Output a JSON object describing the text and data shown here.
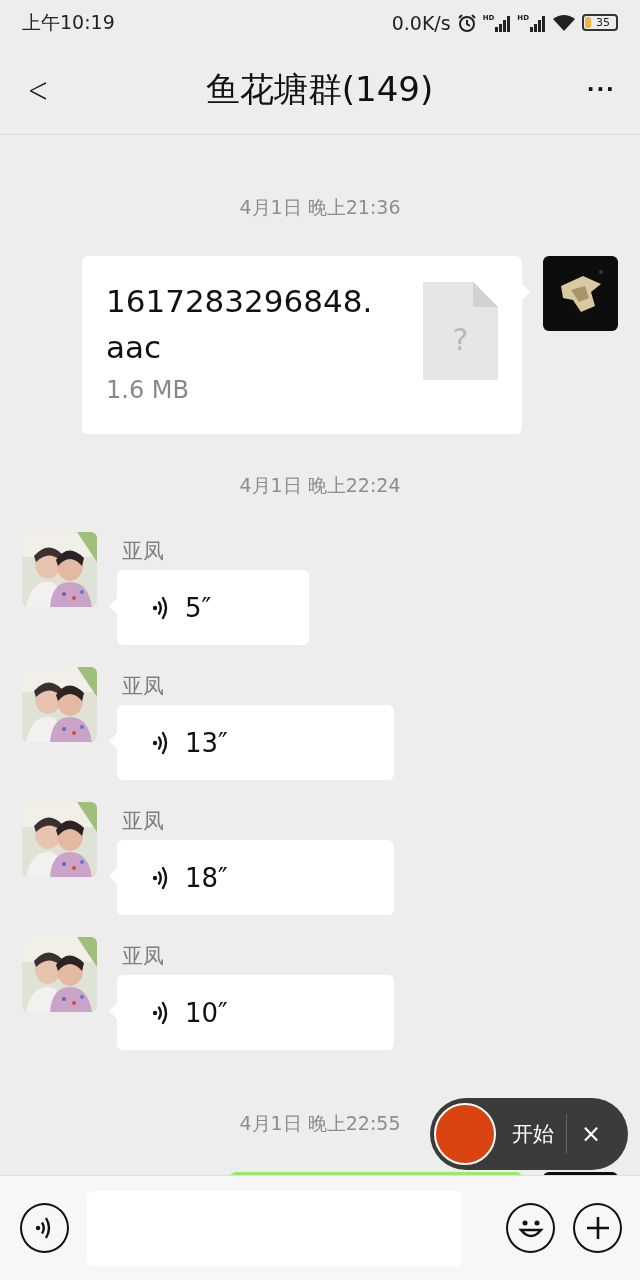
{
  "status_bar": {
    "time": "上午10:19",
    "speed": "0.0K/s",
    "sim_labels": [
      "HD",
      "HD"
    ],
    "battery": "35"
  },
  "header": {
    "title": "鱼花塘群(149)",
    "back": "<",
    "more": "···"
  },
  "messages": [
    {
      "kind": "time",
      "text": "4月1日 晚上21:36"
    },
    {
      "kind": "file",
      "filename": "1617283296848.aac",
      "size": "1.6 MB",
      "icon_glyph": "?"
    },
    {
      "kind": "time",
      "text": "4月1日 晚上22:24"
    },
    {
      "kind": "voice",
      "sender": "亚凤",
      "duration": "5″"
    },
    {
      "kind": "voice",
      "sender": "亚凤",
      "duration": "13″"
    },
    {
      "kind": "voice",
      "sender": "亚凤",
      "duration": "18″"
    },
    {
      "kind": "voice",
      "sender": "亚凤",
      "duration": "10″"
    },
    {
      "kind": "time",
      "text": "4月1日 晚上22:55"
    },
    {
      "kind": "bubble"
    }
  ],
  "recorder": {
    "label": "开始",
    "close": "×"
  }
}
